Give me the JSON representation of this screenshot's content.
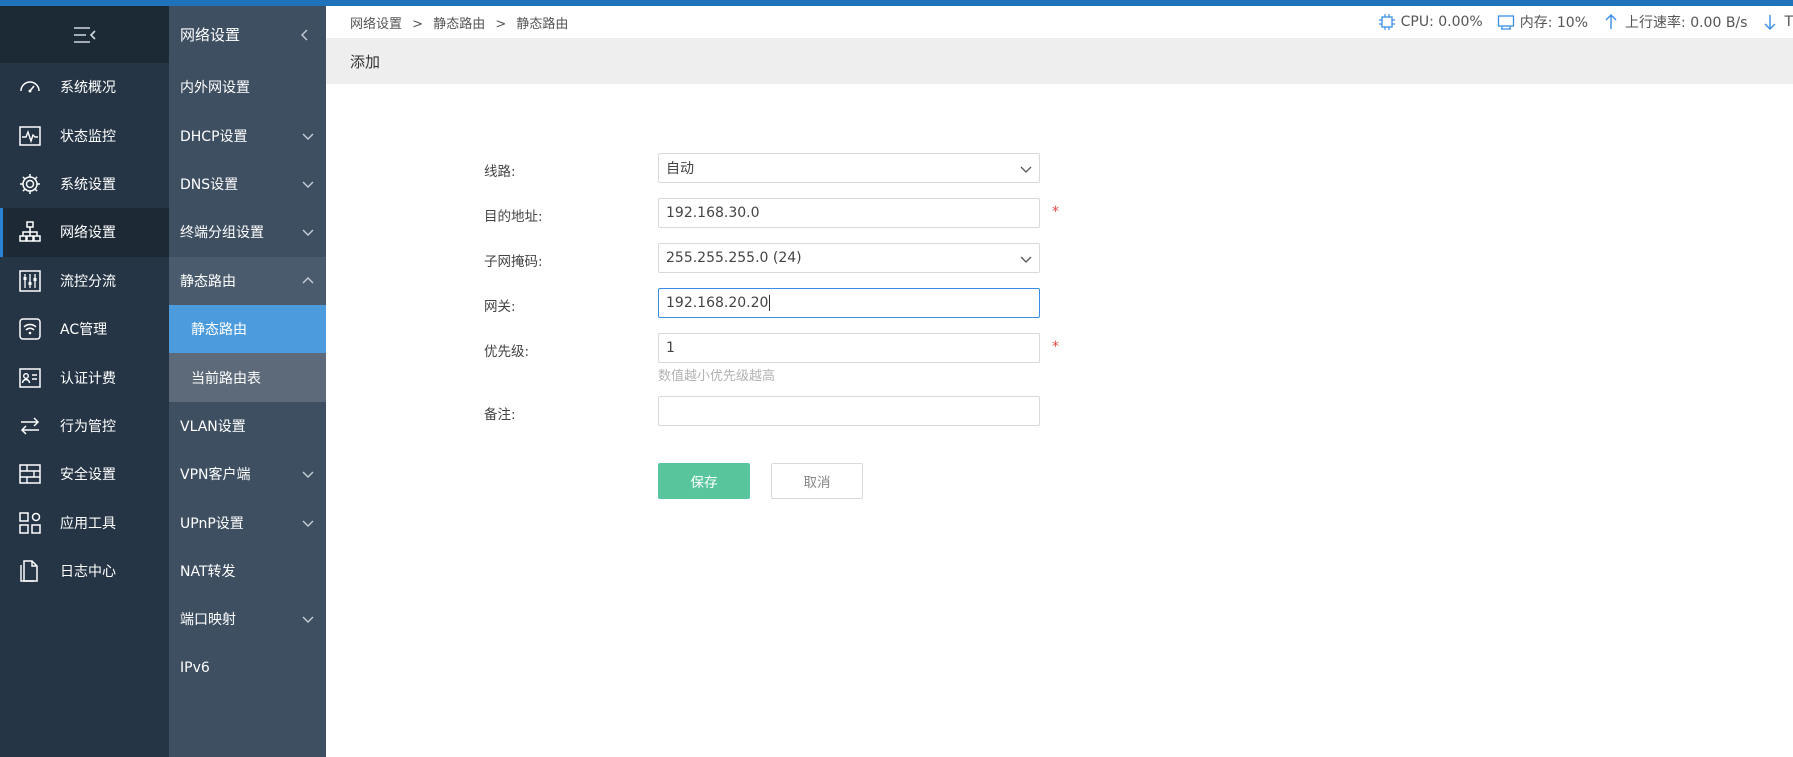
{
  "breadcrumb": [
    "网络设置",
    ">",
    "静态路由",
    ">",
    "静态路由"
  ],
  "status": {
    "cpu": "CPU: 0.00%",
    "memory": "内存: 10%",
    "upload": "上行速率: 0.00 B/s",
    "download": "T"
  },
  "sidebar": {
    "items": [
      {
        "label": "系统概况",
        "icon": "dashboard-icon"
      },
      {
        "label": "状态监控",
        "icon": "monitor-icon"
      },
      {
        "label": "系统设置",
        "icon": "gear-icon"
      },
      {
        "label": "网络设置",
        "icon": "network-icon"
      },
      {
        "label": "流控分流",
        "icon": "sliders-icon"
      },
      {
        "label": "AC管理",
        "icon": "wifi-icon"
      },
      {
        "label": "认证计费",
        "icon": "id-card-icon"
      },
      {
        "label": "行为管控",
        "icon": "arrows-icon"
      },
      {
        "label": "安全设置",
        "icon": "firewall-icon"
      },
      {
        "label": "应用工具",
        "icon": "apps-icon"
      },
      {
        "label": "日志中心",
        "icon": "document-icon"
      }
    ]
  },
  "subnav": {
    "title": "网络设置",
    "items": [
      {
        "label": "内外网设置"
      },
      {
        "label": "DHCP设置"
      },
      {
        "label": "DNS设置"
      },
      {
        "label": "终端分组设置"
      },
      {
        "label": "静态路由"
      },
      {
        "label": "静态路由"
      },
      {
        "label": "当前路由表"
      },
      {
        "label": "VLAN设置"
      },
      {
        "label": "VPN客户端"
      },
      {
        "label": "UPnP设置"
      },
      {
        "label": "NAT转发"
      },
      {
        "label": "端口映射"
      },
      {
        "label": "IPv6"
      }
    ]
  },
  "page": {
    "title": "添加"
  },
  "form": {
    "line_label": "线路:",
    "line_value": "自动",
    "dest_label": "目的地址:",
    "dest_value": "192.168.30.0",
    "mask_label": "子网掩码:",
    "mask_value": "255.255.255.0 (24)",
    "gateway_label": "网关:",
    "gateway_value": "192.168.20.20",
    "priority_label": "优先级:",
    "priority_value": "1",
    "priority_hint": "数值越小优先级越高",
    "note_label": "备注:",
    "note_value": "",
    "required_mark": "*",
    "save_label": "保存",
    "cancel_label": "取消"
  },
  "colors": {
    "accent": "#1f73bb",
    "sidebar_dark": "#253545",
    "sidebar_mid": "#3e4f61",
    "active_sub": "#4c9cdd",
    "save_button": "#59c59d",
    "required": "#e64545"
  }
}
